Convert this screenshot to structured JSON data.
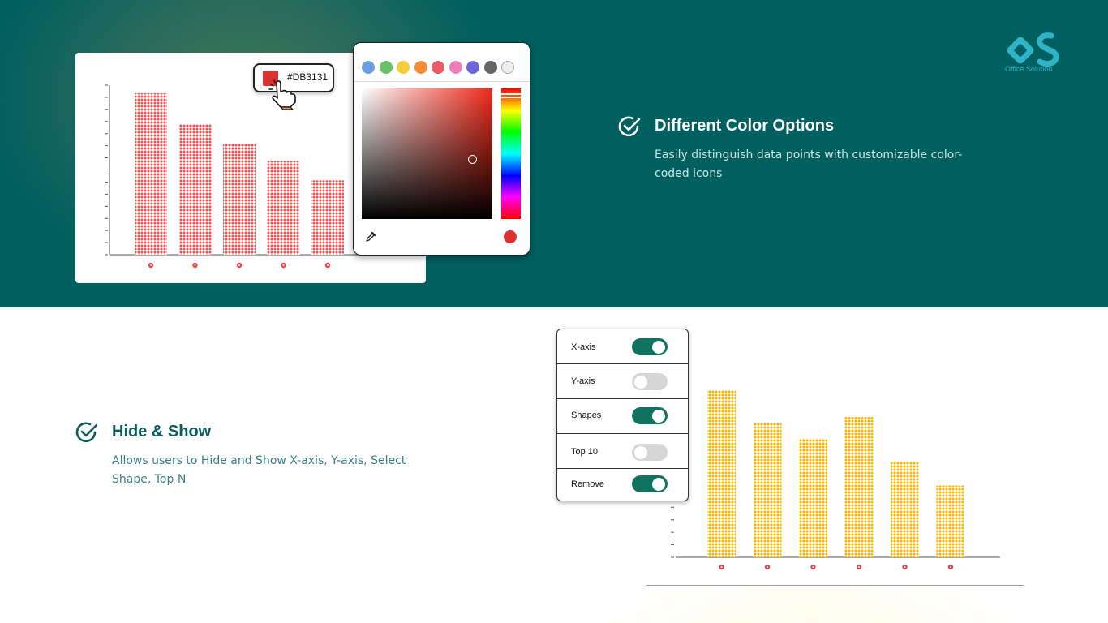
{
  "brand": {
    "logo_text": "Office Solution",
    "logo_icon": "os-logo-icon"
  },
  "colors": {
    "top_band": "#005f5f",
    "accent_teal": "#10735f",
    "selected_red": "#DB3131",
    "bar_yellow": "#f5b400",
    "text_teal_dark": "#0b5d5d"
  },
  "features": [
    {
      "title": "Different Color Options",
      "description": "Easily distinguish data points with customizable color-coded icons",
      "icon": "check-circle-icon"
    },
    {
      "title": "Hide & Show",
      "description": "Allows users to Hide and Show X-axis, Y-axis, Select Shape, Top N",
      "icon": "check-circle-icon"
    }
  ],
  "color_picker": {
    "hex_value": "#DB3131",
    "swatches": [
      "#6a9fe0",
      "#6cc06c",
      "#f4cc3c",
      "#f08c3a",
      "#ea5b63",
      "#ec7fb8",
      "#6f66d6",
      "#666666",
      "#eeeeee"
    ],
    "current": "#db3131",
    "eyedropper_icon": "eyedropper-icon",
    "cursor_icon": "hand-pointer-icon"
  },
  "toggles": [
    {
      "label": "X-axis",
      "on": true
    },
    {
      "label": "Y-axis",
      "on": false
    },
    {
      "label": "Shapes",
      "on": true
    },
    {
      "label": "Top 10",
      "on": false
    },
    {
      "label": "Remove",
      "on": true
    }
  ],
  "chart_data": [
    {
      "type": "bar",
      "color": "#e65555",
      "values": [
        100,
        81,
        69,
        58,
        46
      ],
      "ylim": [
        0,
        105
      ],
      "x_tick_icon": "red-dot-icon"
    },
    {
      "type": "bar",
      "color": "#f5b400",
      "values": [
        100,
        81,
        71,
        84,
        57,
        43
      ],
      "ylim": [
        0,
        105
      ],
      "x_tick_icon": "red-dot-icon"
    }
  ]
}
